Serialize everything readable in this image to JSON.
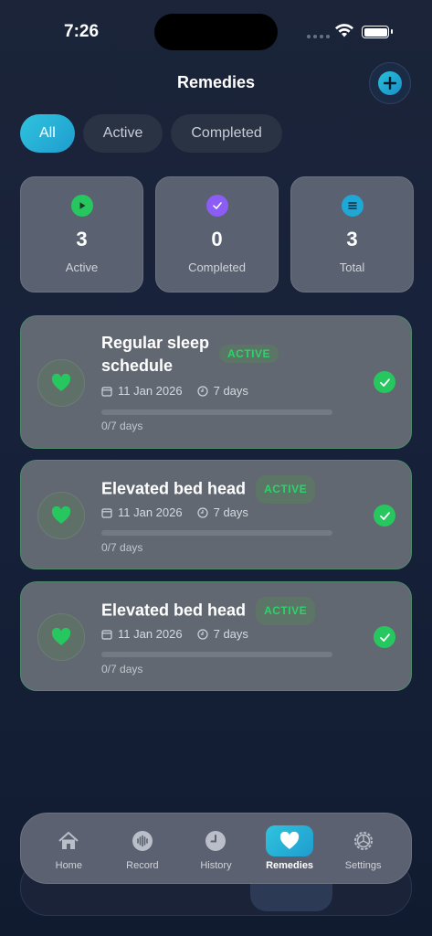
{
  "status": {
    "time": "7:26"
  },
  "header": {
    "title": "Remedies",
    "add_icon": "plus-icon"
  },
  "filters": [
    {
      "label": "All",
      "selected": true
    },
    {
      "label": "Active",
      "selected": false
    },
    {
      "label": "Completed",
      "selected": false
    }
  ],
  "stats": [
    {
      "icon": "play-icon",
      "color": "#27c760",
      "value": "3",
      "label": "Active"
    },
    {
      "icon": "check-icon",
      "color": "#8b5cf6",
      "value": "0",
      "label": "Completed"
    },
    {
      "icon": "list-icon",
      "color": "#1fa7d6",
      "value": "3",
      "label": "Total"
    }
  ],
  "remedies": [
    {
      "title": "Regular sleep schedule",
      "badge": "ACTIVE",
      "date": "11 Jan 2026",
      "duration": "7 days",
      "progress_text": "0/7 days",
      "progress": 0
    },
    {
      "title": "Elevated bed head",
      "badge": "ACTIVE",
      "date": "11 Jan 2026",
      "duration": "7 days",
      "progress_text": "0/7 days",
      "progress": 0
    },
    {
      "title": "Elevated bed head",
      "badge": "ACTIVE",
      "date": "11 Jan 2026",
      "duration": "7 days",
      "progress_text": "0/7 days",
      "progress": 0
    }
  ],
  "tabs": [
    {
      "label": "Home",
      "icon": "home-icon",
      "selected": false
    },
    {
      "label": "Record",
      "icon": "waveform-icon",
      "selected": false
    },
    {
      "label": "History",
      "icon": "clock-icon",
      "selected": false
    },
    {
      "label": "Remedies",
      "icon": "heart-icon",
      "selected": true
    },
    {
      "label": "Settings",
      "icon": "gear-icon",
      "selected": false
    }
  ],
  "colors": {
    "accent": "#1fb5d8",
    "success": "#27c760",
    "background": "#17213a"
  }
}
